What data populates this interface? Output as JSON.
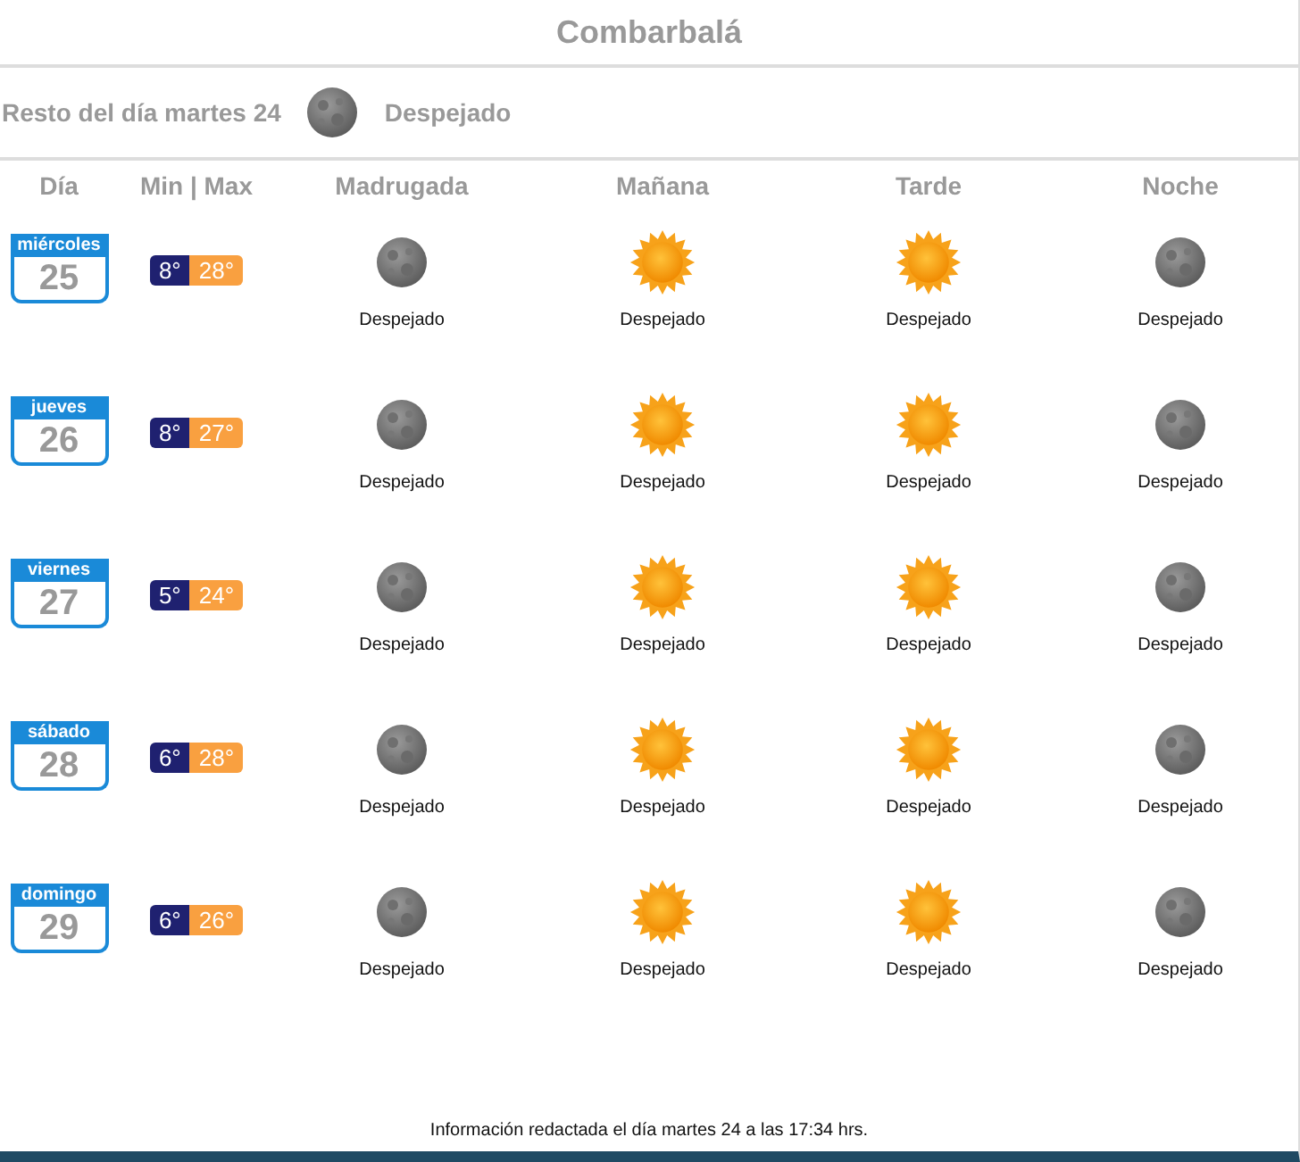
{
  "title": "Combarbalá",
  "today": {
    "label": "Resto del día martes 24",
    "kind": "moon",
    "condition": "Despejado"
  },
  "columns": [
    "Día",
    "Min | Max",
    "Madrugada",
    "Mañana",
    "Tarde",
    "Noche"
  ],
  "days": [
    {
      "weekday": "miércoles",
      "date": "25",
      "min": "8°",
      "max": "28°",
      "periods": [
        {
          "kind": "moon",
          "condition": "Despejado"
        },
        {
          "kind": "sun",
          "condition": "Despejado"
        },
        {
          "kind": "sun",
          "condition": "Despejado"
        },
        {
          "kind": "moon",
          "condition": "Despejado"
        }
      ]
    },
    {
      "weekday": "jueves",
      "date": "26",
      "min": "8°",
      "max": "27°",
      "periods": [
        {
          "kind": "moon",
          "condition": "Despejado"
        },
        {
          "kind": "sun",
          "condition": "Despejado"
        },
        {
          "kind": "sun",
          "condition": "Despejado"
        },
        {
          "kind": "moon",
          "condition": "Despejado"
        }
      ]
    },
    {
      "weekday": "viernes",
      "date": "27",
      "min": "5°",
      "max": "24°",
      "periods": [
        {
          "kind": "moon",
          "condition": "Despejado"
        },
        {
          "kind": "sun",
          "condition": "Despejado"
        },
        {
          "kind": "sun",
          "condition": "Despejado"
        },
        {
          "kind": "moon",
          "condition": "Despejado"
        }
      ]
    },
    {
      "weekday": "sábado",
      "date": "28",
      "min": "6°",
      "max": "28°",
      "periods": [
        {
          "kind": "moon",
          "condition": "Despejado"
        },
        {
          "kind": "sun",
          "condition": "Despejado"
        },
        {
          "kind": "sun",
          "condition": "Despejado"
        },
        {
          "kind": "moon",
          "condition": "Despejado"
        }
      ]
    },
    {
      "weekday": "domingo",
      "date": "29",
      "min": "6°",
      "max": "26°",
      "periods": [
        {
          "kind": "moon",
          "condition": "Despejado"
        },
        {
          "kind": "sun",
          "condition": "Despejado"
        },
        {
          "kind": "sun",
          "condition": "Despejado"
        },
        {
          "kind": "moon",
          "condition": "Despejado"
        }
      ]
    }
  ],
  "footer": "Información redactada el día martes 24 a las 17:34 hrs."
}
